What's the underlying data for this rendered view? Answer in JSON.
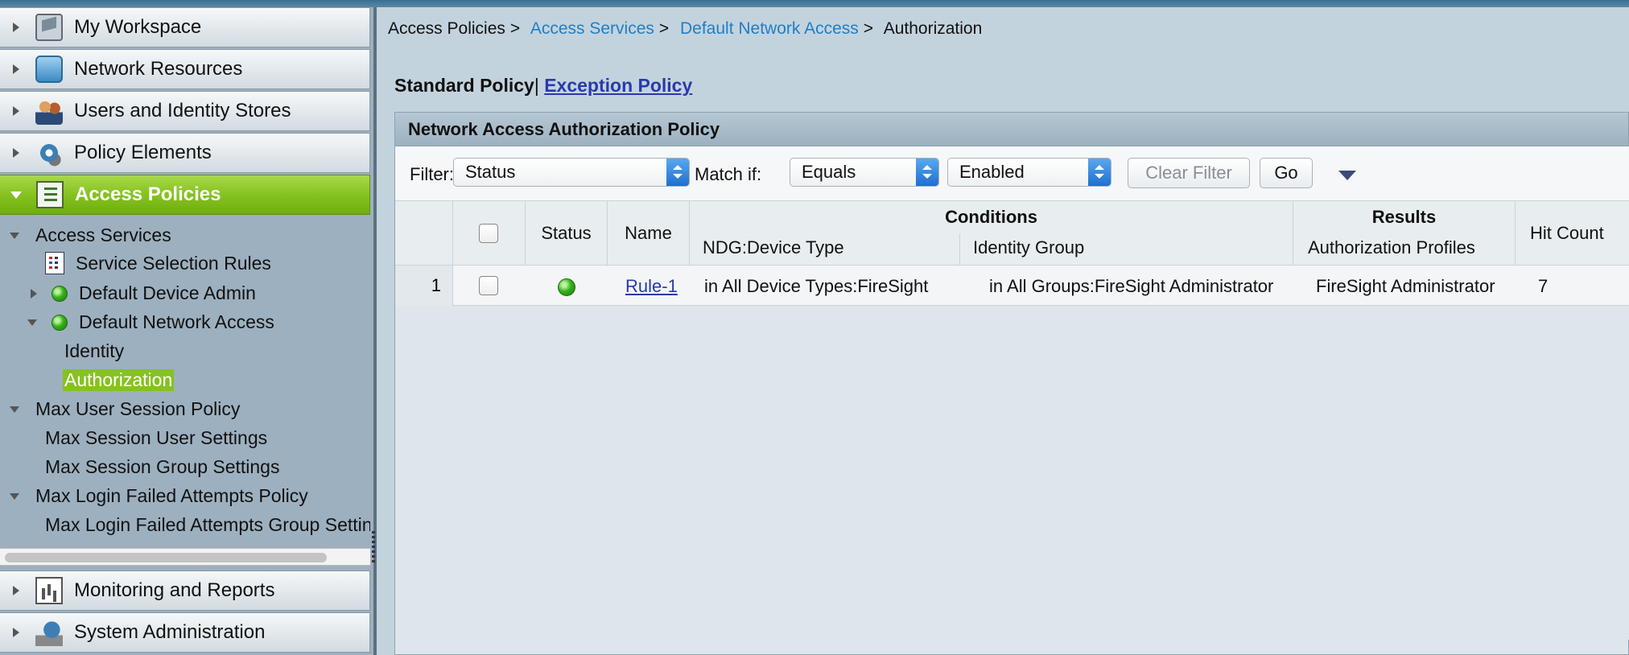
{
  "sidebar": {
    "drawers_top": [
      {
        "label": "My Workspace",
        "icon": "workspace-icon"
      },
      {
        "label": "Network Resources",
        "icon": "network-resources-icon"
      },
      {
        "label": "Users and Identity Stores",
        "icon": "users-icon"
      },
      {
        "label": "Policy Elements",
        "icon": "policy-elements-icon"
      },
      {
        "label": "Access Policies",
        "icon": "access-policies-icon",
        "active": true
      }
    ],
    "tree": [
      {
        "label": "Access Services"
      },
      {
        "label": "Service Selection Rules"
      },
      {
        "label": "Default Device Admin"
      },
      {
        "label": "Default Network Access"
      },
      {
        "label": "Identity"
      },
      {
        "label": "Authorization",
        "selected": true
      },
      {
        "label": "Max User Session Policy"
      },
      {
        "label": "Max Session User Settings"
      },
      {
        "label": "Max Session Group Settings"
      },
      {
        "label": "Max Login Failed Attempts Policy"
      },
      {
        "label": "Max Login Failed Attempts Group Settings"
      }
    ],
    "drawers_bottom": [
      {
        "label": "Monitoring and Reports",
        "icon": "monitoring-icon"
      },
      {
        "label": "System Administration",
        "icon": "system-admin-icon"
      }
    ]
  },
  "breadcrumb": {
    "items": [
      "Access Policies",
      "Access Services",
      "Default Network Access",
      "Authorization"
    ],
    "separator": ">"
  },
  "policy_tabs": {
    "standard": "Standard Policy",
    "divider": "|",
    "exception": "Exception Policy"
  },
  "panel": {
    "title": "Network Access Authorization Policy"
  },
  "filter": {
    "filter_label": "Filter:",
    "filter_value": "Status",
    "match_label": "Match if:",
    "match_value": "Equals",
    "value": "Enabled",
    "clear_button": "Clear Filter",
    "go_button": "Go"
  },
  "table": {
    "headers": {
      "status": "Status",
      "name": "Name",
      "conditions": "Conditions",
      "ndg_device_type": "NDG:Device Type",
      "identity_group": "Identity Group",
      "results": "Results",
      "authorization_profiles": "Authorization Profiles",
      "hit_count": "Hit Count"
    },
    "rows": [
      {
        "num": "1",
        "status": "enabled",
        "name": "Rule-1",
        "ndg_device_type": "in All Device Types:FireSight",
        "identity_group": "in All Groups:FireSight Administrator",
        "authorization_profiles": "FireSight Administrator",
        "hit_count": "7"
      }
    ]
  },
  "colors": {
    "active_green": "#86c220",
    "link_blue": "#1f7fc4",
    "link_dark_blue": "#2a3aa8"
  }
}
